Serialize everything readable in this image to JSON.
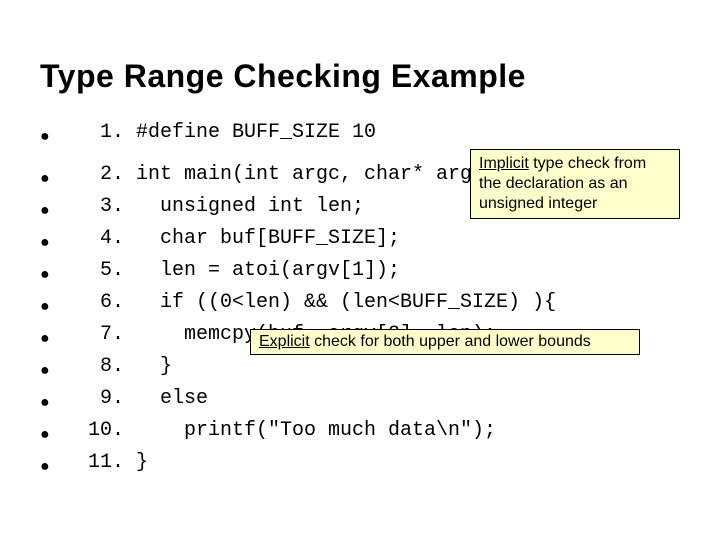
{
  "title": "Type Range Checking Example",
  "bullet_glyph": "●",
  "lines": [
    {
      "n": "1.",
      "code": "#define BUFF_SIZE 10"
    },
    {
      "n": "2.",
      "code": "int main(int argc, char* argv[]){"
    },
    {
      "n": "3.",
      "code": "  unsigned int len;"
    },
    {
      "n": "4.",
      "code": "  char buf[BUFF_SIZE];"
    },
    {
      "n": "5.",
      "code": "  len = atoi(argv[1]);"
    },
    {
      "n": "6.",
      "code": "  if ((0<len) && (len<BUFF_SIZE) ){"
    },
    {
      "n": "7.",
      "code": "    memcpy(buf, argv[2], len);"
    },
    {
      "n": "8.",
      "code": "  }"
    },
    {
      "n": "9.",
      "code": "  else"
    },
    {
      "n": "10.",
      "code": "    printf(\"Too much data\\n\");"
    },
    {
      "n": "11.",
      "code": "}"
    }
  ],
  "callouts": {
    "implicit": {
      "underlined": "Implicit",
      "rest": " type check from the declaration as an unsigned integer"
    },
    "explicit": {
      "underlined": "Explicit",
      "rest": " check for both upper and lower bounds"
    }
  }
}
